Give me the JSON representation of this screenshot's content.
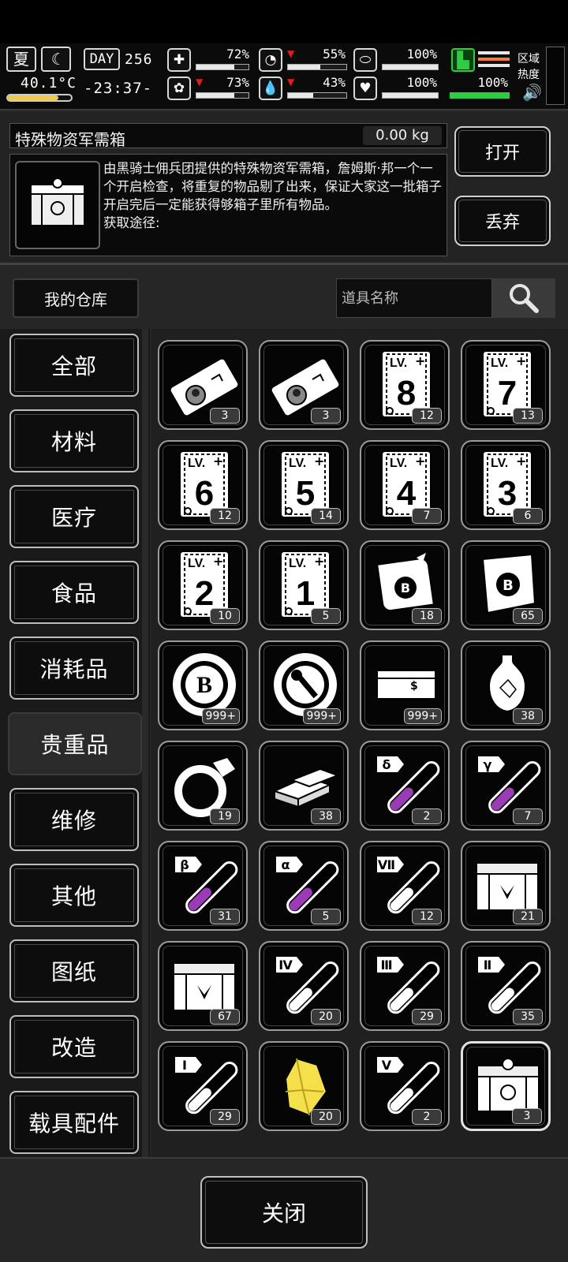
{
  "hud": {
    "season": "夏",
    "temperature": "40.1°C",
    "day_label": "DAY",
    "day_number": "256",
    "clock": "-23:37-",
    "stats_left": [
      {
        "icon": "medkit-icon",
        "value": "72%",
        "level": 0.72,
        "arrow": false
      },
      {
        "icon": "brain-icon",
        "value": "73%",
        "level": 0.73,
        "arrow": true
      }
    ],
    "stats_mid": [
      {
        "icon": "stomach-icon",
        "value": "55%",
        "level": 0.55,
        "arrow": true
      },
      {
        "icon": "water-drop-icon",
        "value": "43%",
        "level": 0.43,
        "arrow": true
      }
    ],
    "stats_right": [
      {
        "icon": "pill-icon",
        "value": "100%",
        "level": 1.0
      },
      {
        "icon": "heart-icon",
        "value": "100%",
        "level": 1.0
      }
    ],
    "stamina_value": "100%",
    "stamina_level": 1.0,
    "region_heat_label": "区域热度",
    "accent_green": "#2ecc40",
    "warn_orange": "#ff7a2e",
    "arrow_red": "#e01c1c"
  },
  "detail": {
    "item_name": "特殊物资军需箱",
    "weight": "0.00 kg",
    "description": "由黑骑士佣兵团提供的特殊物资军需箱，詹姆斯·邦一个一个开启检查，将重复的物品剔了出来，保证大家这一批箱子开启完后一定能获得够箱子里所有物品。",
    "source_label": "获取途径:",
    "open_button": "打开",
    "discard_button": "丢弃"
  },
  "toolbar": {
    "warehouse_button": "我的仓库",
    "search_placeholder": "道具名称"
  },
  "categories": [
    "全部",
    "材料",
    "医疗",
    "食品",
    "消耗品",
    "贵重品",
    "维修",
    "其他",
    "图纸",
    "改造",
    "载具配件"
  ],
  "active_category": "贵重品",
  "items": [
    {
      "icon": "ticket-portrait-icon",
      "count": "3"
    },
    {
      "icon": "ticket-portrait-icon",
      "count": "3"
    },
    {
      "icon": "level-card-icon",
      "level_text": "8",
      "count": "12"
    },
    {
      "icon": "level-card-icon",
      "level_text": "7",
      "count": "13"
    },
    {
      "icon": "level-card-icon",
      "level_text": "6",
      "count": "12"
    },
    {
      "icon": "level-card-icon",
      "level_text": "5",
      "count": "14"
    },
    {
      "icon": "level-card-icon",
      "level_text": "4",
      "count": "7"
    },
    {
      "icon": "level-card-icon",
      "level_text": "3",
      "count": "6"
    },
    {
      "icon": "level-card-icon",
      "level_text": "2",
      "count": "10"
    },
    {
      "icon": "level-card-icon",
      "level_text": "1",
      "count": "5"
    },
    {
      "icon": "scroll-icon",
      "count": "18"
    },
    {
      "icon": "torn-map-icon",
      "count": "65"
    },
    {
      "icon": "b-coin-icon",
      "count": "999+"
    },
    {
      "icon": "wrench-coin-icon",
      "count": "999+"
    },
    {
      "icon": "cash-stack-icon",
      "count": "999+"
    },
    {
      "icon": "vase-icon",
      "count": "38"
    },
    {
      "icon": "ring-icon",
      "count": "19"
    },
    {
      "icon": "gold-bars-icon",
      "count": "38"
    },
    {
      "icon": "test-tube-icon",
      "tube_label": "δ",
      "tube_fill": "purple",
      "count": "2"
    },
    {
      "icon": "test-tube-icon",
      "tube_label": "γ",
      "tube_fill": "purple",
      "count": "7"
    },
    {
      "icon": "test-tube-icon",
      "tube_label": "β",
      "tube_fill": "purple",
      "count": "31"
    },
    {
      "icon": "test-tube-icon",
      "tube_label": "α",
      "tube_fill": "purple",
      "count": "5"
    },
    {
      "icon": "test-tube-icon",
      "tube_label": "Ⅶ",
      "tube_fill": "white",
      "count": "12"
    },
    {
      "icon": "supply-crate-icon",
      "count": "21"
    },
    {
      "icon": "supply-crate-icon",
      "count": "67"
    },
    {
      "icon": "test-tube-icon",
      "tube_label": "Ⅳ",
      "tube_fill": "white",
      "count": "20"
    },
    {
      "icon": "test-tube-icon",
      "tube_label": "Ⅲ",
      "tube_fill": "white",
      "count": "29"
    },
    {
      "icon": "test-tube-icon",
      "tube_label": "Ⅱ",
      "tube_fill": "white",
      "count": "35"
    },
    {
      "icon": "test-tube-icon",
      "tube_label": "Ⅰ",
      "tube_fill": "white",
      "count": "29"
    },
    {
      "icon": "yellow-crystal-icon",
      "count": "20"
    },
    {
      "icon": "test-tube-icon",
      "tube_label": "Ⅴ",
      "tube_fill": "white",
      "count": "2"
    },
    {
      "icon": "special-crate-icon",
      "count": "3",
      "selected": true
    }
  ],
  "colors": {
    "purple": "#9b3bb5",
    "crystal": "#f4e04a"
  },
  "close_button": "关闭"
}
